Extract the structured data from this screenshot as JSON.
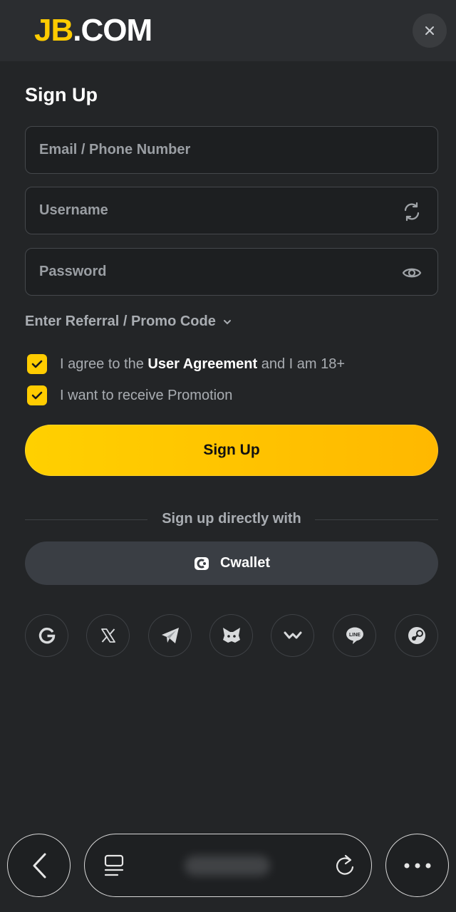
{
  "header": {
    "logo_jb": "JB",
    "logo_com": ".COM",
    "close_icon": "close-icon"
  },
  "form": {
    "title": "Sign Up",
    "email_placeholder": "Email / Phone Number",
    "username_placeholder": "Username",
    "password_placeholder": "Password",
    "referral_label": "Enter Referral / Promo Code",
    "agree_prefix": "I agree to the ",
    "agree_link": "User Agreement",
    "agree_suffix": " and I am 18+",
    "agree_checked": true,
    "promotion_label": "I want to receive Promotion",
    "promotion_checked": true,
    "submit_label": "Sign Up"
  },
  "alt_signup": {
    "divider_text": "Sign up directly with",
    "cwallet_label": "Cwallet",
    "socials": [
      "google-icon",
      "x-icon",
      "telegram-icon",
      "metamask-icon",
      "walletconnect-icon",
      "line-icon",
      "steam-icon"
    ]
  },
  "colors": {
    "accent": "#ffcc00",
    "background": "#232527",
    "header": "#2b2d30"
  }
}
